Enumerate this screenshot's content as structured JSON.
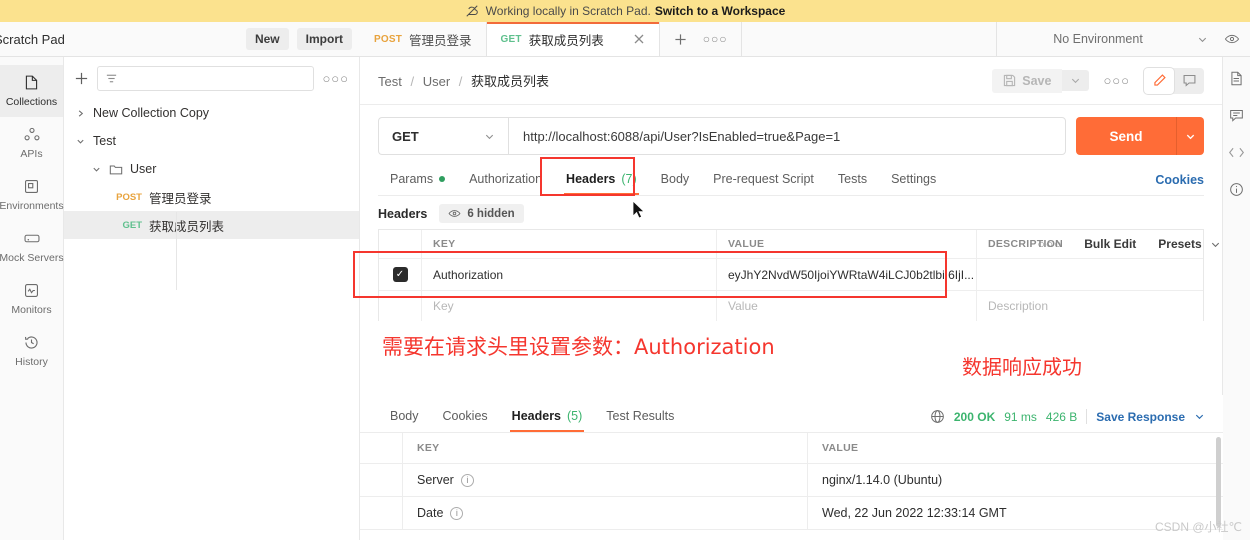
{
  "banner": {
    "icon": "cloud-off-icon",
    "text": "Working locally in Scratch Pad.",
    "link": "Switch to a Workspace"
  },
  "header": {
    "scratch_title": "Scratch Pad",
    "new_button": "New",
    "import_button": "Import",
    "tabs": [
      {
        "method": "POST",
        "name": "管理员登录",
        "active": false
      },
      {
        "method": "GET",
        "name": "获取成员列表",
        "active": true
      }
    ],
    "new_tab_icon": "plus-icon",
    "tab_options_icon": "ellipsis-icon",
    "environment": "No Environment",
    "eye_icon": "eye-icon",
    "chevron_icon": "chevron-down-icon"
  },
  "sidebar": {
    "items": [
      {
        "label": "Collections",
        "icon": "collections-icon",
        "active": true
      },
      {
        "label": "APIs",
        "icon": "apis-icon",
        "active": false
      },
      {
        "label": "Environments",
        "icon": "environments-icon",
        "active": false
      },
      {
        "label": "Mock Servers",
        "icon": "mock-servers-icon",
        "active": false
      },
      {
        "label": "Monitors",
        "icon": "monitors-icon",
        "active": false
      },
      {
        "label": "History",
        "icon": "history-icon",
        "active": false
      }
    ]
  },
  "collections": {
    "add_icon": "plus-icon",
    "filter_icon": "filter-icon",
    "filter_placeholder": "",
    "more_icon": "ellipsis-icon",
    "tree": [
      {
        "label": "New Collection Copy",
        "level": 0,
        "chevron": "›",
        "method": "",
        "selected": false
      },
      {
        "label": "Test",
        "level": 0,
        "chevron": "⌄",
        "method": "",
        "selected": false
      },
      {
        "label": "User",
        "level": 1,
        "chevron": "⌄",
        "method": "",
        "selected": false,
        "folder": true
      },
      {
        "label": "管理员登录",
        "level": 2,
        "chevron": "",
        "method": "POST",
        "selected": false
      },
      {
        "label": "获取成员列表",
        "level": 2,
        "chevron": "",
        "method": "GET",
        "selected": true
      }
    ]
  },
  "request": {
    "breadcrumb": {
      "parts": [
        "Test",
        "User"
      ],
      "last": "获取成员列表",
      "separator": "/"
    },
    "save_label": "Save",
    "save_icon": "floppy-icon",
    "save_caret_icon": "chevron-down-icon",
    "more_icon": "ellipsis-icon",
    "pencil_icon": "pencil-icon",
    "comment_icon": "comment-icon",
    "method": "GET",
    "method_caret_icon": "chevron-down-icon",
    "url": "http://localhost:6088/api/User?IsEnabled=true&Page=1",
    "send_label": "Send",
    "send_caret_icon": "chevron-down-icon",
    "tabs": [
      {
        "label": "Params",
        "dot": true,
        "count": "",
        "active": false
      },
      {
        "label": "Authorization",
        "dot": false,
        "count": "",
        "active": false
      },
      {
        "label": "Headers",
        "dot": false,
        "count": "(7)",
        "active": true
      },
      {
        "label": "Body",
        "dot": false,
        "count": "",
        "active": false
      },
      {
        "label": "Pre-request Script",
        "dot": false,
        "count": "",
        "active": false
      },
      {
        "label": "Tests",
        "dot": false,
        "count": "",
        "active": false
      },
      {
        "label": "Settings",
        "dot": false,
        "count": "",
        "active": false
      }
    ],
    "cookies_link": "Cookies",
    "headers_section_title": "Headers",
    "hidden_pill": "6 hidden",
    "hidden_pill_icon": "eye-icon",
    "table": {
      "columns": [
        "KEY",
        "VALUE",
        "DESCRIPTION"
      ],
      "rows": [
        {
          "checked": true,
          "key": "Authorization",
          "value": "eyJhY2NvdW50IjoiYWRtaW4iLCJ0b2tlbiI6IjI...",
          "description": ""
        }
      ],
      "placeholder_row": {
        "key": "Key",
        "value": "Value",
        "description": "Description"
      },
      "actions": {
        "dots": "○○○",
        "bulk_edit": "Bulk Edit",
        "presets": "Presets",
        "presets_caret": "chevron-down-icon"
      }
    }
  },
  "response": {
    "tabs": [
      {
        "label": "Body",
        "count": "",
        "active": false
      },
      {
        "label": "Cookies",
        "count": "",
        "active": false
      },
      {
        "label": "Headers",
        "count": "(5)",
        "active": true
      },
      {
        "label": "Test Results",
        "count": "",
        "active": false
      }
    ],
    "globe_icon": "globe-icon",
    "status": "200 OK",
    "time": "91 ms",
    "size": "426 B",
    "save_response": "Save Response",
    "save_response_caret": "chevron-down-icon",
    "table": {
      "columns": [
        "KEY",
        "VALUE"
      ],
      "rows": [
        {
          "key": "Server",
          "value": "nginx/1.14.0 (Ubuntu)",
          "info": true
        },
        {
          "key": "Date",
          "value": "Wed, 22 Jun 2022 12:33:14 GMT",
          "info": true
        }
      ]
    }
  },
  "annotations": [
    {
      "text": "需要在请求头里设置参数：Authorization",
      "color": "#f5362e"
    },
    {
      "text": "数据响应成功",
      "color": "#f5362e"
    }
  ],
  "right_rail": {
    "items": [
      {
        "icon": "documentation-icon"
      },
      {
        "icon": "comment-icon"
      },
      {
        "icon": "code-icon"
      },
      {
        "icon": "info-icon"
      }
    ]
  },
  "watermark": "CSDN @小社℃",
  "colors": {
    "accent": "#ff6c37",
    "banner": "#fbe28e",
    "annotation": "#f5362e",
    "success": "#3cb46e",
    "link": "#2b6cb0"
  }
}
